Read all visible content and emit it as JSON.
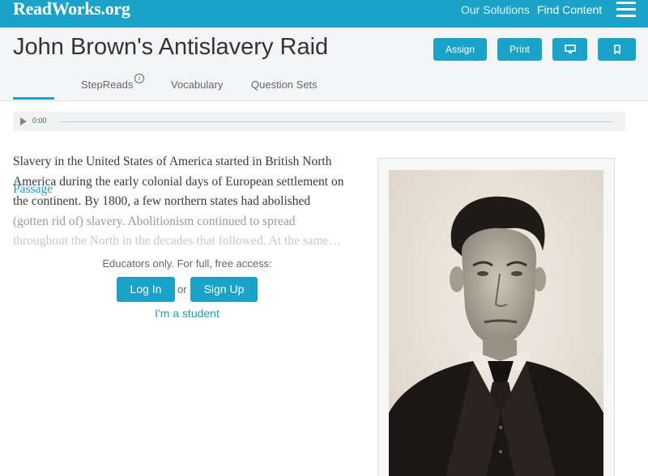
{
  "nav": {
    "logo": "ReadWorks.org",
    "links": [
      "Our Solutions",
      "Find Content"
    ]
  },
  "header": {
    "title": "John Brown's Antislavery Raid",
    "buttons": {
      "assign": "Assign",
      "print": "Print"
    },
    "tabs": [
      "Passage",
      "StepReads",
      "Vocabulary",
      "Question Sets"
    ],
    "active_tab": "Passage",
    "info_glyph": "i"
  },
  "audio": {
    "time": "0:00",
    "progress": 0
  },
  "passage": {
    "lines": [
      "Slavery in the United States of America started in British North",
      "America during the early colonial days of European settlement on",
      "the continent. By 1800, a few northern states had abolished",
      "(gotten rid of) slavery. Abolitionism continued to spread",
      "throughout the North in the decades that followed. At the same…"
    ]
  },
  "access": {
    "prompt": "Educators only. For full, free access:",
    "login": "Log In",
    "or": "or",
    "signup": "Sign Up",
    "student": "I'm a student"
  },
  "colors": {
    "accent": "#1ba2c9",
    "header_bg": "#f4f5f6"
  },
  "icons": [
    "hamburger-menu-icon",
    "info-icon",
    "present-icon",
    "bookmark-icon",
    "play-icon"
  ]
}
